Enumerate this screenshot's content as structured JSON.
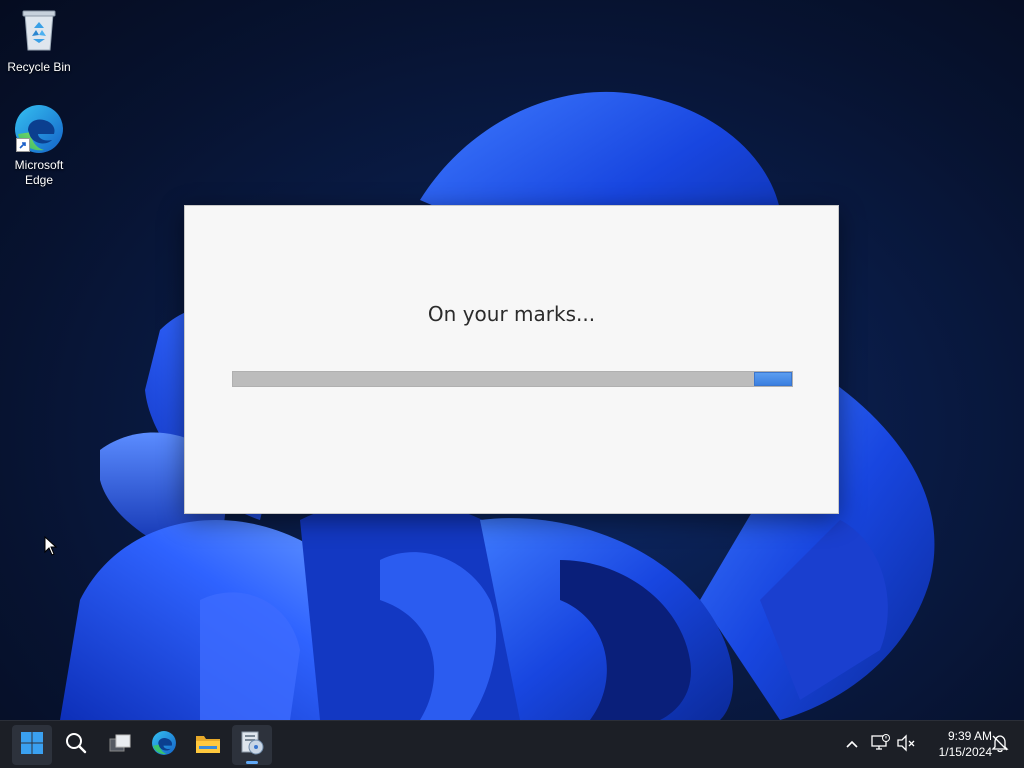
{
  "desktop": {
    "icons": [
      {
        "label": "Recycle Bin",
        "icon": "recycle-bin-icon"
      },
      {
        "label": "Microsoft Edge",
        "label_line1": "Microsoft",
        "label_line2": "Edge",
        "icon": "edge-icon"
      }
    ]
  },
  "dialog": {
    "message": "On your marks...",
    "progress": "indeterminate marquee"
  },
  "taskbar": {
    "buttons": [
      {
        "name": "start",
        "icon": "windows-start-icon"
      },
      {
        "name": "search",
        "icon": "search-icon"
      },
      {
        "name": "task-view",
        "icon": "task-view-icon"
      },
      {
        "name": "edge",
        "icon": "edge-icon"
      },
      {
        "name": "file-explorer",
        "icon": "folder-icon"
      },
      {
        "name": "setup",
        "icon": "setup-disc-icon",
        "active": true
      }
    ],
    "tray": {
      "icons": [
        "chevron-up-icon",
        "network-disconnected-icon",
        "volume-muted-icon",
        "notification-icon"
      ],
      "time": "9:39 AM",
      "date": "1/15/2024"
    }
  },
  "colors": {
    "accent": "#3b7fe0",
    "taskbar": "#1c1f26",
    "dialog_bg": "#f7f7f7"
  }
}
